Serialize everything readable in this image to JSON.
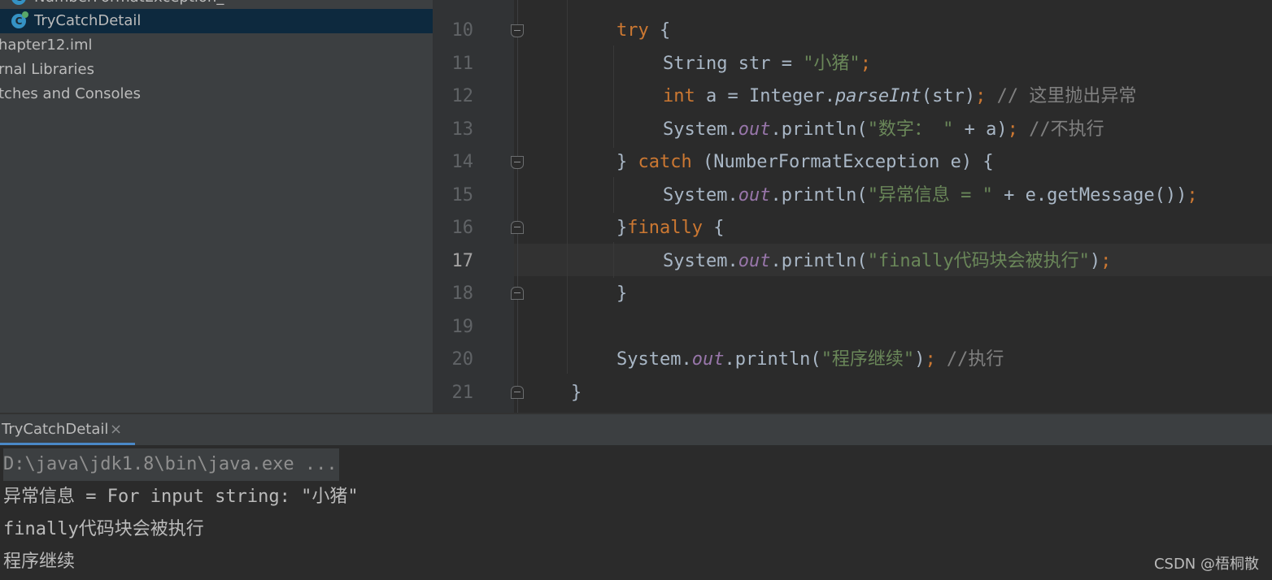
{
  "project_tree": {
    "items": [
      {
        "label": "NumberFormatException_",
        "kind": "class"
      },
      {
        "label": "TryCatchDetail",
        "kind": "class",
        "selected": true
      },
      {
        "label": "hapter12.iml",
        "kind": "file"
      },
      {
        "label": "rnal Libraries",
        "kind": "folder"
      },
      {
        "label": "tches and Consoles",
        "kind": "folder"
      }
    ]
  },
  "editor": {
    "current_line": 17,
    "line_numbers": [
      "10",
      "11",
      "12",
      "13",
      "14",
      "15",
      "16",
      "17",
      "18",
      "19",
      "20",
      "21"
    ],
    "lines": [
      {
        "n": "10",
        "tokens": [
          {
            "t": "try",
            "c": "kw"
          },
          {
            "t": " {",
            "c": "plain"
          }
        ]
      },
      {
        "n": "11",
        "tokens": [
          {
            "t": "String str = ",
            "c": "plain"
          },
          {
            "t": "\"小猪\"",
            "c": "str"
          },
          {
            "t": ";",
            "c": "punc"
          }
        ]
      },
      {
        "n": "12",
        "tokens": [
          {
            "t": "int",
            "c": "kw"
          },
          {
            "t": " a = Integer.",
            "c": "plain"
          },
          {
            "t": "parseInt",
            "c": "mth"
          },
          {
            "t": "(str)",
            "c": "plain"
          },
          {
            "t": ";",
            "c": "punc"
          },
          {
            "t": " // 这里抛出异常",
            "c": "cmt"
          }
        ]
      },
      {
        "n": "13",
        "tokens": [
          {
            "t": "System.",
            "c": "plain"
          },
          {
            "t": "out",
            "c": "fld"
          },
          {
            "t": ".println(",
            "c": "plain"
          },
          {
            "t": "\"数字： \"",
            "c": "str"
          },
          {
            "t": " + a)",
            "c": "plain"
          },
          {
            "t": ";",
            "c": "punc"
          },
          {
            "t": " //不执行",
            "c": "cmt"
          }
        ]
      },
      {
        "n": "14",
        "tokens": [
          {
            "t": "} ",
            "c": "plain"
          },
          {
            "t": "catch",
            "c": "kw"
          },
          {
            "t": " (NumberFormatException e) {",
            "c": "plain"
          }
        ]
      },
      {
        "n": "15",
        "tokens": [
          {
            "t": "System.",
            "c": "plain"
          },
          {
            "t": "out",
            "c": "fld"
          },
          {
            "t": ".println(",
            "c": "plain"
          },
          {
            "t": "\"异常信息 = \"",
            "c": "str"
          },
          {
            "t": " + e.getMessage())",
            "c": "plain"
          },
          {
            "t": ";",
            "c": "punc"
          }
        ]
      },
      {
        "n": "16",
        "tokens": [
          {
            "t": "}",
            "c": "plain"
          },
          {
            "t": "finally",
            "c": "kw"
          },
          {
            "t": " {",
            "c": "plain"
          }
        ]
      },
      {
        "n": "17",
        "tokens": [
          {
            "t": "System.",
            "c": "plain"
          },
          {
            "t": "out",
            "c": "fld"
          },
          {
            "t": ".println(",
            "c": "plain"
          },
          {
            "t": "\"finally代码块会被执行\"",
            "c": "str"
          },
          {
            "t": ")",
            "c": "plain"
          },
          {
            "t": ";",
            "c": "punc"
          }
        ]
      },
      {
        "n": "18",
        "tokens": [
          {
            "t": "}",
            "c": "plain"
          }
        ]
      },
      {
        "n": "19",
        "tokens": []
      },
      {
        "n": "20",
        "tokens": [
          {
            "t": "System.",
            "c": "plain"
          },
          {
            "t": "out",
            "c": "fld"
          },
          {
            "t": ".println(",
            "c": "plain"
          },
          {
            "t": "\"程序继续\"",
            "c": "str"
          },
          {
            "t": ")",
            "c": "plain"
          },
          {
            "t": ";",
            "c": "punc"
          },
          {
            "t": " //执行",
            "c": "cmt"
          }
        ]
      },
      {
        "n": "21",
        "tokens": [
          {
            "t": "}",
            "c": "plain"
          }
        ]
      }
    ]
  },
  "run_panel": {
    "tab_label": "TryCatchDetail",
    "tab_close": "×",
    "output": [
      "D:\\java\\jdk1.8\\bin\\java.exe ...",
      "异常信息 = For input string: \"小猪\"",
      "finally代码块会被执行",
      "程序继续"
    ]
  },
  "watermark": "CSDN @梧桐散",
  "colors": {
    "keyword": "#cc7832",
    "string": "#6a8759",
    "comment": "#808080",
    "field": "#9876aa",
    "selection": "#0d293e",
    "tab_underline": "#4a88c7"
  }
}
